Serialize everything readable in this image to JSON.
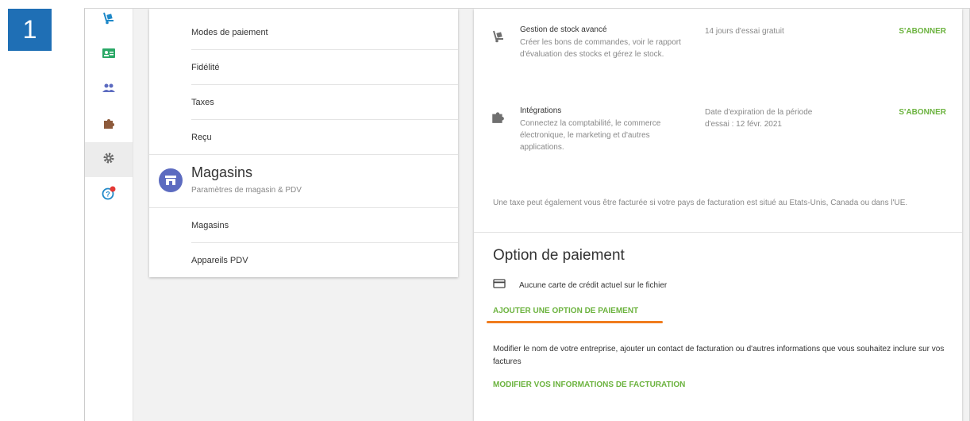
{
  "step": {
    "number": "1"
  },
  "rail": {
    "items": [
      {
        "icon": "hand-truck-icon"
      },
      {
        "icon": "id-card-icon"
      },
      {
        "icon": "people-icon"
      },
      {
        "icon": "puzzle-icon"
      },
      {
        "icon": "gear-icon",
        "active": true
      },
      {
        "icon": "help-notification-icon"
      }
    ]
  },
  "settings_menu": {
    "items_top": [
      "Modes de paiement",
      "Fidélité",
      "Taxes",
      "Reçu"
    ],
    "stores_section": {
      "title": "Magasins",
      "subtitle": "Paramètres de magasin & PDV",
      "items": [
        "Magasins",
        "Appareils PDV"
      ]
    }
  },
  "subscriptions": [
    {
      "name": "Gestion de stock avancé",
      "description": "Créer les bons de commandes, voir le rapport d'évaluation des stocks et gérez le stock.",
      "trial": "14 jours d'essai gratuit",
      "action": "S'ABONNER"
    },
    {
      "name": "Intégrations",
      "description": "Connectez la comptabilité, le commerce électronique, le marketing et d'autres applications.",
      "trial": "Date d'expiration de la période d'essai : 12 févr. 2021",
      "action": "S'ABONNER"
    }
  ],
  "tax_note": "Une taxe peut également vous être facturée si votre pays de facturation est situé au Etats-Unis, Canada ou dans l'UE.",
  "payment": {
    "title": "Option de paiement",
    "no_card_text": "Aucune carte de crédit actuel sur le fichier",
    "add_option": "AJOUTER UNE OPTION DE PAIEMENT",
    "billing_description": "Modifier le nom de votre entreprise, ajouter un contact de facturation ou d'autres informations que vous souhaitez inclure sur vos factures",
    "edit_billing": "MODIFIER VOS INFORMATIONS DE FACTURATION"
  },
  "colors": {
    "accent_green": "#6cb33f",
    "highlight_orange": "#f07c1e",
    "step_blue": "#1f6fb5",
    "rail_blue": "#1e88c8"
  }
}
